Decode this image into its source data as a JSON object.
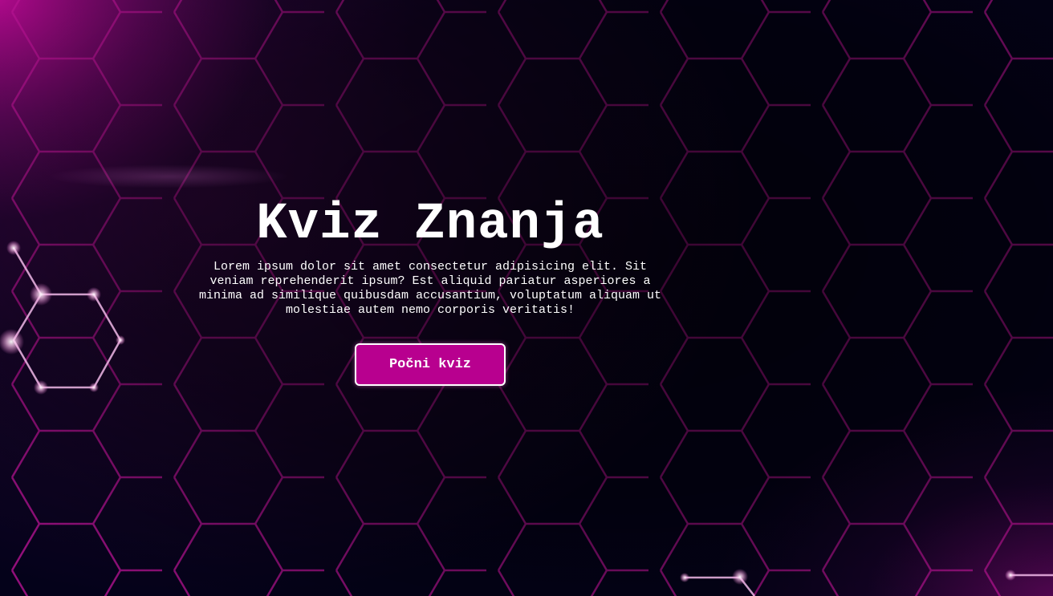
{
  "hero": {
    "title": "Kviz Znanja",
    "description": "Lorem ipsum dolor sit amet consectetur adipisicing elit. Sit veniam reprehenderit ipsum? Est aliquid pariatur asperiores a minima ad similique quibusdam accusantium, voluptatum aliquam ut molestiae autem nemo corporis veritatis!",
    "start_button_label": "Počni kviz"
  },
  "colors": {
    "background": "#04021a",
    "accent": "#b8008f",
    "hex_line": "#c0139a",
    "text": "#ffffff"
  }
}
